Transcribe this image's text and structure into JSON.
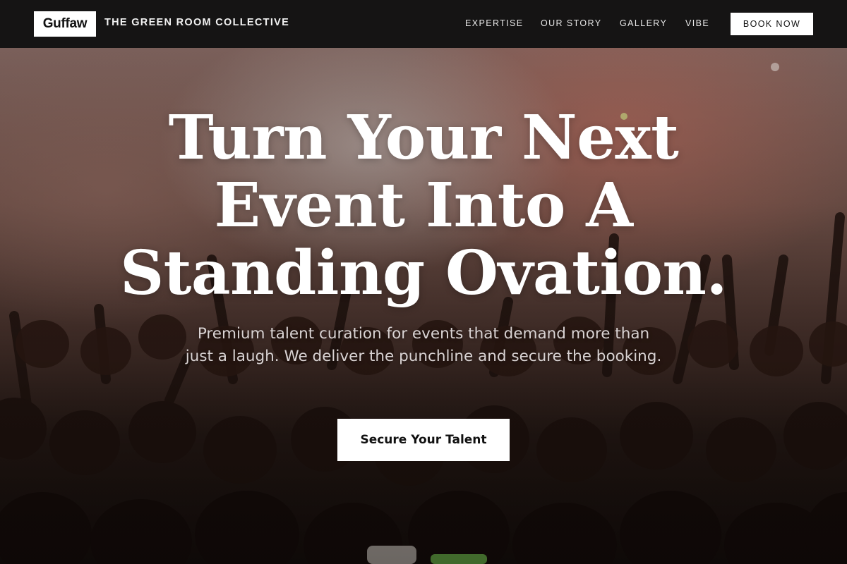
{
  "header": {
    "logo_text": "Guffaw",
    "brand_name": "THE GREEN ROOM COLLECTIVE",
    "nav": [
      {
        "label": "EXPERTISE"
      },
      {
        "label": "OUR STORY"
      },
      {
        "label": "GALLERY"
      },
      {
        "label": "VIBE"
      }
    ],
    "book_label": "BOOK NOW"
  },
  "hero": {
    "headline_lines": [
      "Turn Your Next",
      "Event Into A",
      "Standing Ovation."
    ],
    "subheadline": "Premium talent curation for events that demand more than just a laugh. We deliver the punchline and secure the booking.",
    "cta_label": "Secure Your Talent",
    "background_icon": "concert-crowd-photo"
  },
  "colors": {
    "header_bg": "#151414",
    "button_bg": "#ffffff",
    "text_light": "#ffffff"
  }
}
